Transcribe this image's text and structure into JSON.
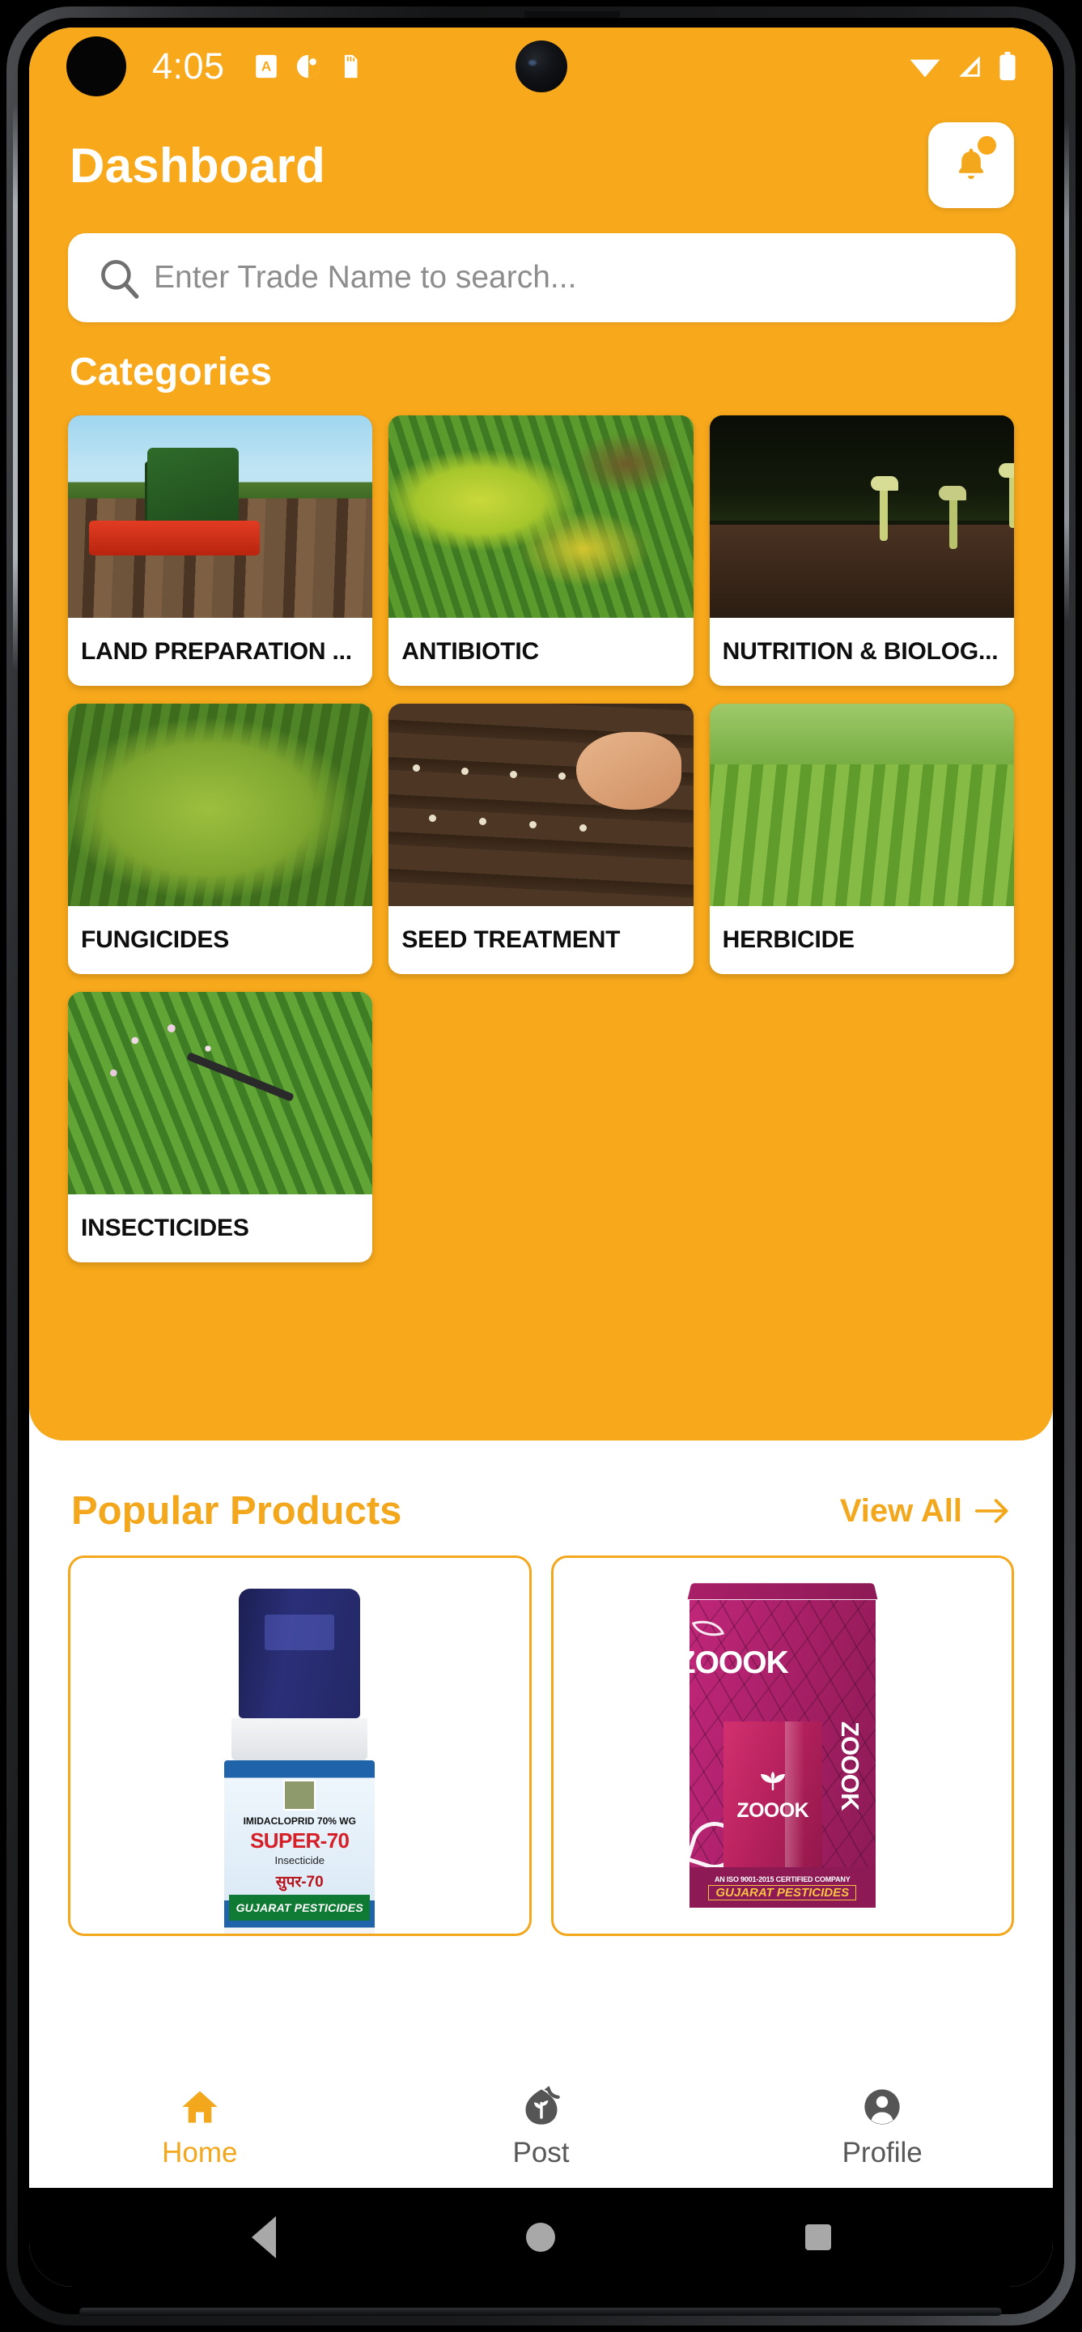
{
  "status_bar": {
    "time": "4:05",
    "left_icons": [
      "alphabet-mode-icon",
      "do-not-disturb-icon",
      "sd-card-icon"
    ],
    "right_icons": [
      "wifi-icon",
      "cellular-signal-icon",
      "battery-icon"
    ]
  },
  "header": {
    "title": "Dashboard",
    "notification_icon": "bell-icon",
    "has_badge": true
  },
  "search": {
    "placeholder": "Enter Trade Name to search...",
    "value": "",
    "icon": "search-icon"
  },
  "categories": {
    "title": "Categories",
    "items": [
      {
        "label": "LAND PREPARATION ...",
        "image": "tractor-tilling-field"
      },
      {
        "label": "ANTIBIOTIC",
        "image": "yellowing-diseased-leaves"
      },
      {
        "label": "NUTRITION & BIOLOG...",
        "image": "sprouting-seedlings-in-soil"
      },
      {
        "label": "FUNGICIDES",
        "image": "spotted-diseased-leaf"
      },
      {
        "label": "SEED TREATMENT",
        "image": "hand-sowing-seeds-in-rows"
      },
      {
        "label": "HERBICIDE",
        "image": "young-corn-crop-rows"
      },
      {
        "label": "INSECTICIDES",
        "image": "spraying-green-crop"
      }
    ]
  },
  "popular_products": {
    "title": "Popular Products",
    "view_all_label": "View All",
    "view_all_icon": "arrow-right-icon",
    "items": [
      {
        "name": "SUPER-70",
        "active_ingredient": "IMIDACLOPRID 70% WG",
        "type": "Insecticide",
        "name_hindi": "सुपर-70",
        "brand": "GUJARAT PESTICIDES"
      },
      {
        "name": "ZOOOK",
        "brand": "GUJARAT PESTICIDES",
        "certification": "AN ISO 9001-2015 CERTIFIED COMPANY"
      }
    ]
  },
  "bottom_nav": {
    "items": [
      {
        "label": "Home",
        "icon": "home-icon",
        "active": true
      },
      {
        "label": "Post",
        "icon": "post-sprout-icon",
        "active": false
      },
      {
        "label": "Profile",
        "icon": "account-circle-icon",
        "active": false
      }
    ]
  },
  "system_nav": {
    "back": "back-triangle-icon",
    "home": "home-circle-icon",
    "recents": "recents-square-icon"
  },
  "colors": {
    "brand_orange": "#F7A81B",
    "accent_orange": "#F2A71C",
    "card_white": "#FFFFFF",
    "text_dark": "#0E0E0E"
  }
}
